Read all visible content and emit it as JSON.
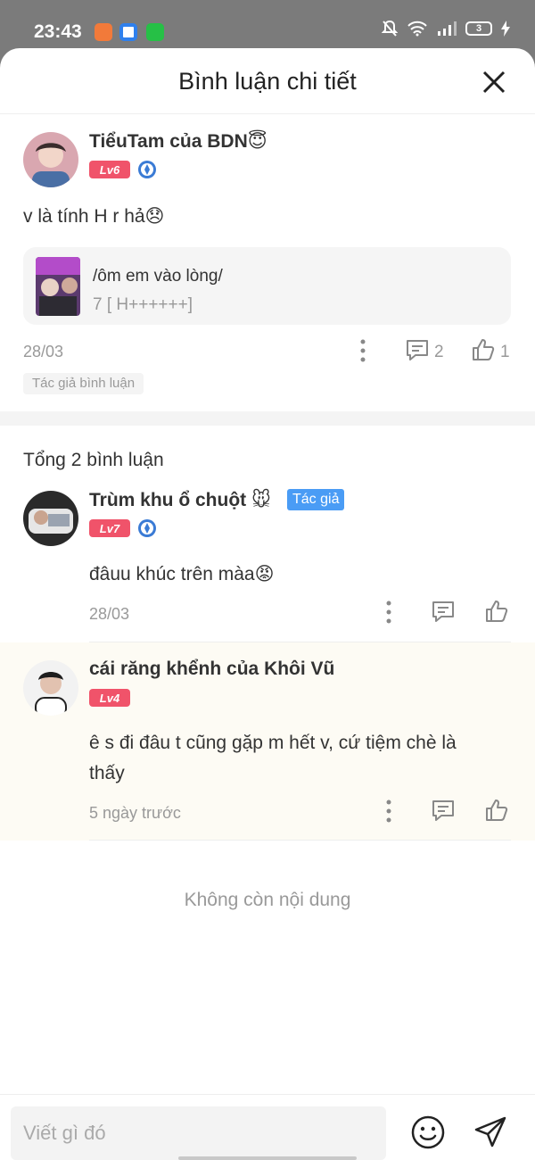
{
  "status_bar": {
    "time": "23:43",
    "battery": "3"
  },
  "header": {
    "title": "Bình luận chi tiết"
  },
  "main_comment": {
    "author": "TiểuTam của BDN😇",
    "level": "Lv6",
    "text": "v là tính H r hả😞",
    "quote": {
      "title": "/ôm em vào lòng/",
      "subtitle": "7 [ H++++++]"
    },
    "date": "28/03",
    "reply_count": "2",
    "like_count": "1",
    "tag": "Tác giả bình luận"
  },
  "replies_header": "Tổng 2 bình luận",
  "replies": [
    {
      "author": "Trùm khu ổ chuột 🐭",
      "badge": "Tác giả",
      "level": "Lv7",
      "text": "đâuu khúc trên màa😡",
      "date": "28/03"
    },
    {
      "author": "cái răng khểnh của Khôi Vũ",
      "level": "Lv4",
      "text_line1": "ê s đi đâu t cũng gặp m hết v, cứ tiệm chè là",
      "text_line2": "thấy",
      "date": "5 ngày trước"
    }
  ],
  "end_text": "Không còn nội dung",
  "composer": {
    "placeholder": "Viết gì đó"
  },
  "colors": {
    "level_badge": "#f0536a",
    "author_badge": "#4a9cf5",
    "highlight": "#fdfbf4"
  }
}
